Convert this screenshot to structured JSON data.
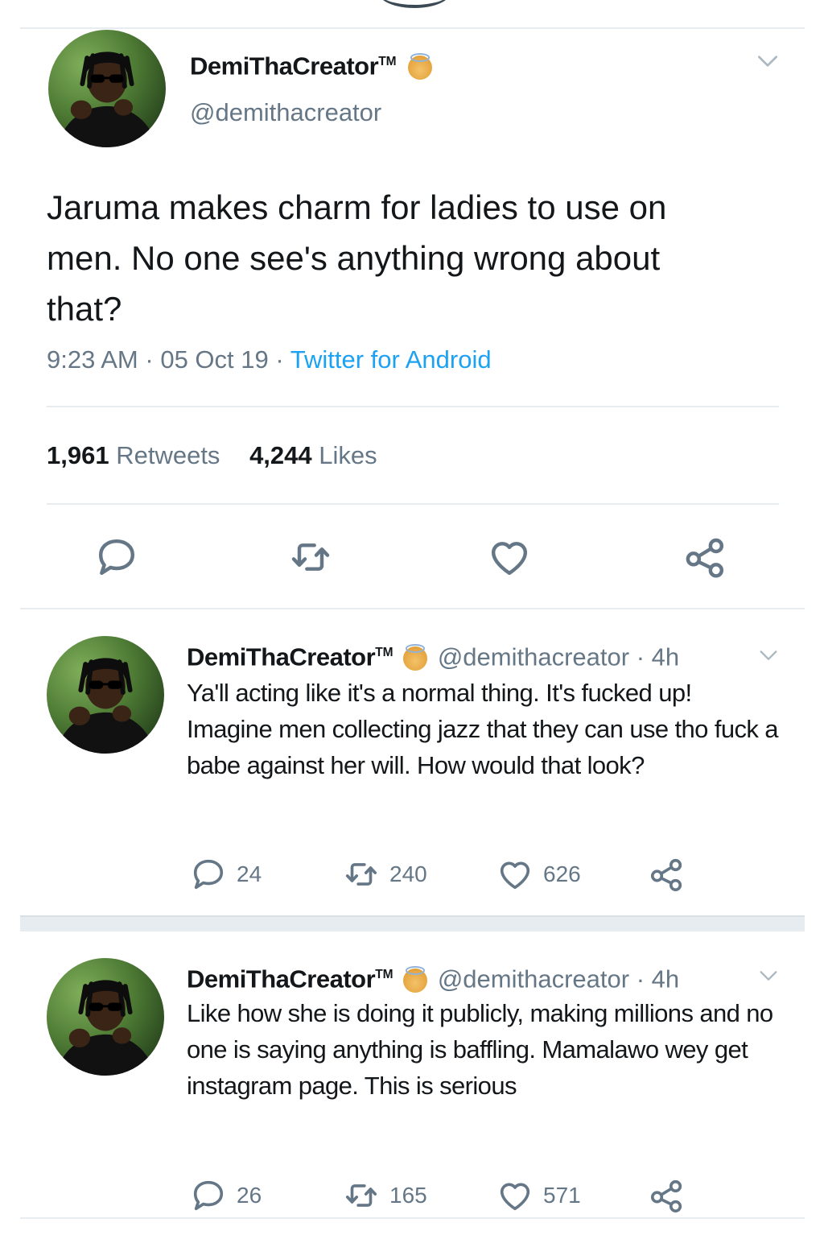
{
  "main_tweet": {
    "display_name": "DemiThaCreator",
    "tm": "TM",
    "handle": "@demithacreator",
    "text": "Jaruma makes charm for ladies to use on men. No one see's anything wrong about that?",
    "time": "9:23 AM",
    "dot1": "·",
    "date": "05 Oct 19",
    "dot2": "·",
    "source": "Twitter for Android",
    "retweets_count": "1,961",
    "retweets_label": "Retweets",
    "likes_count": "4,244",
    "likes_label": "Likes"
  },
  "replies": [
    {
      "display_name": "DemiThaCreator",
      "tm": "TM",
      "handle": "@demithacreator",
      "time": "· 4h",
      "text": "Ya'll acting like it's a normal thing. It's fucked up! Imagine men collecting jazz that they can use tho fuck a babe against her will. How would that look?",
      "replies": "24",
      "retweets": "240",
      "likes": "626"
    },
    {
      "display_name": "DemiThaCreator",
      "tm": "TM",
      "handle": "@demithacreator",
      "time": "· 4h",
      "text": "Like how she is doing it publicly, making millions and no one is saying anything is baffling. Mamalawo wey get instagram page. This is serious",
      "replies": "26",
      "retweets": "165",
      "likes": "571"
    }
  ],
  "colors": {
    "accent": "#1da1f2",
    "secondary_text": "#657786",
    "divider": "#e6ecf0"
  },
  "icons": [
    "reply-icon",
    "retweet-icon",
    "like-icon",
    "share-icon",
    "chevron-down-icon",
    "angel-emoji-icon"
  ]
}
